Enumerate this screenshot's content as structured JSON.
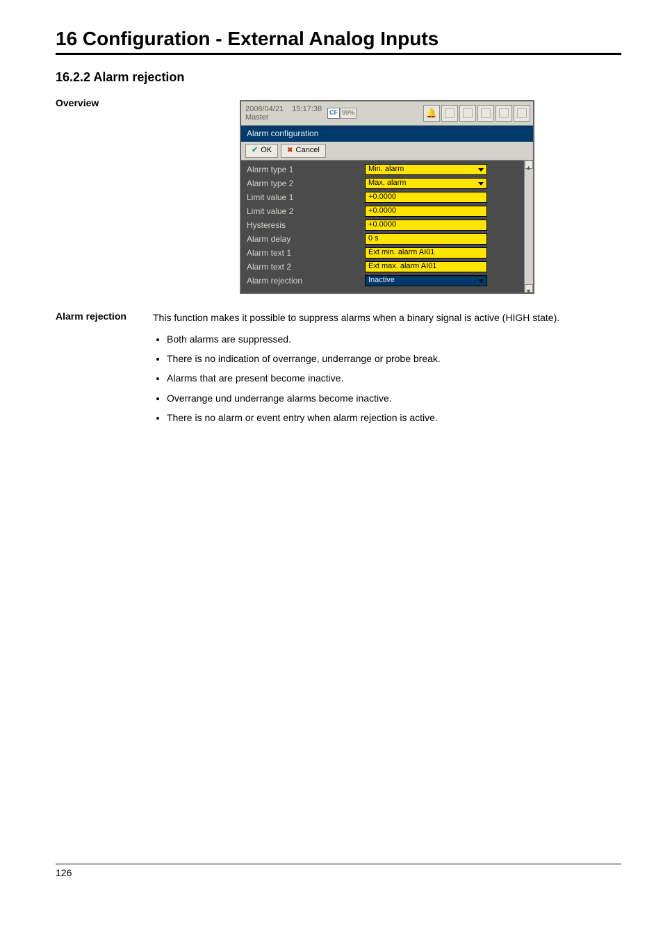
{
  "chapter_title": "16 Configuration - External Analog Inputs",
  "section_number": "16.2.2  Alarm rejection",
  "overview_label": "Overview",
  "alarm_rejection_label": "Alarm rejection",
  "paragraph": "This function makes it possible to suppress alarms when a binary signal is active (HIGH state).",
  "bullets": [
    "Both alarms are suppressed.",
    "There is no indication of overrange, underrange or probe break.",
    "Alarms that are present become inactive.",
    "Overrange und underrange alarms become inactive.",
    "There is no alarm or event entry when alarm rejection is active."
  ],
  "screenshot": {
    "date": "2008/04/21",
    "time": "15:17:38",
    "master": "Master",
    "cf": "CF",
    "pct": "99%",
    "title": "Alarm configuration",
    "ok": "OK",
    "cancel": "Cancel",
    "rows": [
      {
        "label": "Alarm type 1",
        "value": "Min. alarm",
        "kind": "dd",
        "style": "y"
      },
      {
        "label": "Alarm type 2",
        "value": "Max. alarm",
        "kind": "dd",
        "style": "y"
      },
      {
        "label": "Limit value 1",
        "value": "+0.0000",
        "kind": "txt",
        "style": "y"
      },
      {
        "label": "Limit value 2",
        "value": "+0.0000",
        "kind": "txt",
        "style": "y"
      },
      {
        "label": "Hysteresis",
        "value": "+0.0000",
        "kind": "txt",
        "style": "y"
      },
      {
        "label": "Alarm delay",
        "value": "0 s",
        "kind": "txt",
        "style": "y"
      },
      {
        "label": "Alarm text 1",
        "value": "Ext min. alarm AI01",
        "kind": "txt",
        "style": "y"
      },
      {
        "label": "Alarm text 2",
        "value": "Ext max. alarm AI01",
        "kind": "txt",
        "style": "y"
      },
      {
        "label": "Alarm rejection",
        "value": "Inactive",
        "kind": "dd",
        "style": "b"
      }
    ]
  },
  "page_number": "126"
}
